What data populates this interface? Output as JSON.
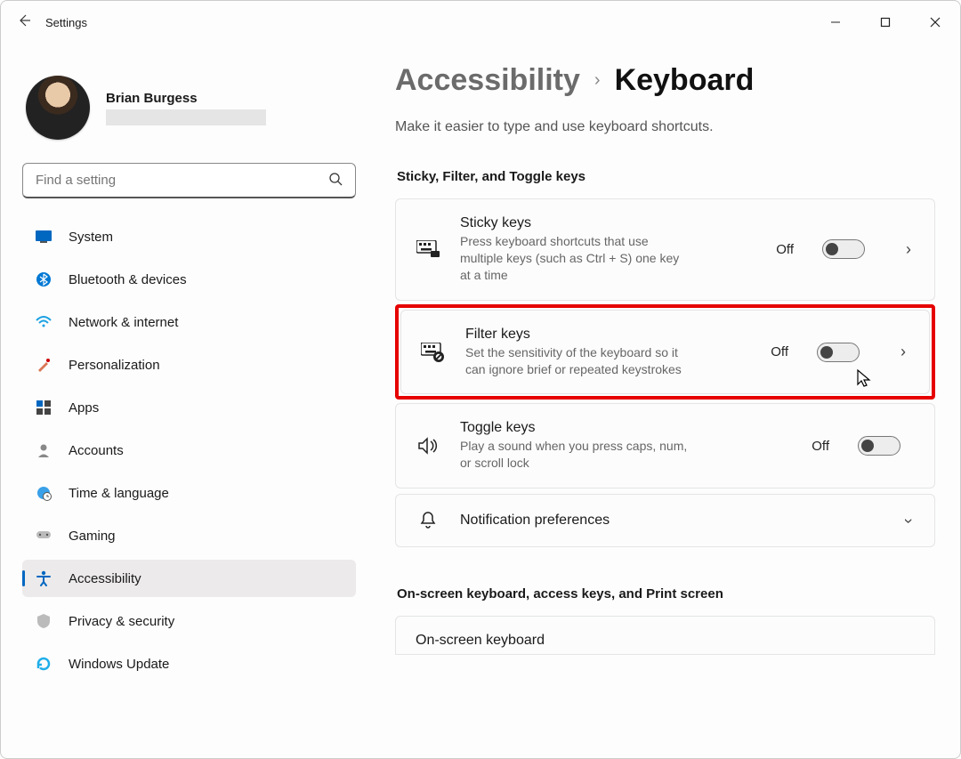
{
  "title": "Settings",
  "user": {
    "name": "Brian Burgess"
  },
  "search": {
    "placeholder": "Find a setting"
  },
  "sidebar": {
    "items": [
      {
        "label": "System"
      },
      {
        "label": "Bluetooth & devices"
      },
      {
        "label": "Network & internet"
      },
      {
        "label": "Personalization"
      },
      {
        "label": "Apps"
      },
      {
        "label": "Accounts"
      },
      {
        "label": "Time & language"
      },
      {
        "label": "Gaming"
      },
      {
        "label": "Accessibility"
      },
      {
        "label": "Privacy & security"
      },
      {
        "label": "Windows Update"
      }
    ]
  },
  "breadcrumb": {
    "parent": "Accessibility",
    "current": "Keyboard"
  },
  "subtitle": "Make it easier to type and use keyboard shortcuts.",
  "sections": {
    "s1": "Sticky, Filter, and Toggle keys",
    "s2": "On-screen keyboard, access keys, and Print screen"
  },
  "cards": {
    "sticky": {
      "title": "Sticky keys",
      "desc": "Press keyboard shortcuts that use multiple keys (such as Ctrl + S) one key at a time",
      "state": "Off"
    },
    "filter": {
      "title": "Filter keys",
      "desc": "Set the sensitivity of the keyboard so it can ignore brief or repeated keystrokes",
      "state": "Off"
    },
    "togglek": {
      "title": "Toggle keys",
      "desc": "Play a sound when you press caps, num, or scroll lock",
      "state": "Off"
    },
    "notif": {
      "title": "Notification preferences"
    },
    "osk": {
      "title": "On-screen keyboard"
    }
  }
}
